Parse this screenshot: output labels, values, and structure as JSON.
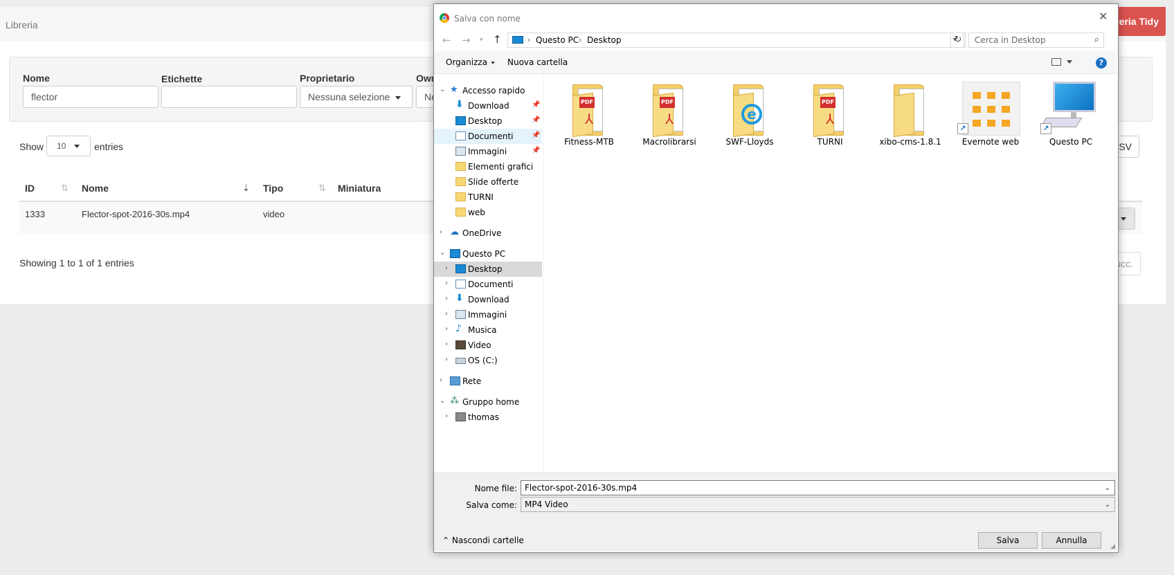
{
  "app": {
    "title": "Libreria",
    "tidy_button": "reria Tidy",
    "filters": {
      "name_label": "Nome",
      "name_value": "flector",
      "tags_label": "Etichette",
      "tags_value": "",
      "owner_label": "Proprietario",
      "owner_value": "Nessuna selezione",
      "own_label": "Owr",
      "own_value": "Ne"
    },
    "show_label": "Show",
    "entries_label": "entries",
    "page_length": "10",
    "csv_label": "CSV",
    "table": {
      "headers": [
        "ID",
        "Nome",
        "Tipo",
        "Miniatura"
      ],
      "rows": [
        {
          "id": "1333",
          "name": "Flector-spot-2016-30s.mp4",
          "type": "video",
          "thumb": ""
        }
      ]
    },
    "info": "Showing 1 to 1 of 1 entries",
    "next_label": "ucc."
  },
  "dialog": {
    "title": "Salva con nome",
    "breadcrumb": [
      "Questo PC",
      "Desktop"
    ],
    "search_placeholder": "Cerca in Desktop",
    "toolbar": {
      "organize": "Organizza",
      "new_folder": "Nuova cartella",
      "help": "?"
    },
    "nav_tree": [
      {
        "label": "Accesso rapido",
        "icon": "quick-access-star-icon"
      },
      {
        "label": "Download",
        "icon": "download-icon",
        "pinned": true
      },
      {
        "label": "Desktop",
        "icon": "desktop-icon",
        "pinned": true
      },
      {
        "label": "Documenti",
        "icon": "documents-icon",
        "pinned": true
      },
      {
        "label": "Immagini",
        "icon": "pictures-icon",
        "pinned": true
      },
      {
        "label": "Elementi grafici",
        "icon": "folder-icon"
      },
      {
        "label": "Slide offerte",
        "icon": "folder-icon"
      },
      {
        "label": "TURNI",
        "icon": "folder-icon"
      },
      {
        "label": "web",
        "icon": "folder-icon"
      },
      {
        "label": "OneDrive",
        "icon": "onedrive-icon"
      },
      {
        "label": "Questo PC",
        "icon": "this-pc-icon"
      },
      {
        "label": "Desktop",
        "icon": "desktop-icon"
      },
      {
        "label": "Documenti",
        "icon": "documents-icon"
      },
      {
        "label": "Download",
        "icon": "download-icon"
      },
      {
        "label": "Immagini",
        "icon": "pictures-icon"
      },
      {
        "label": "Musica",
        "icon": "music-icon"
      },
      {
        "label": "Video",
        "icon": "video-icon"
      },
      {
        "label": "OS (C:)",
        "icon": "drive-icon"
      },
      {
        "label": "Rete",
        "icon": "network-icon"
      },
      {
        "label": "Gruppo home",
        "icon": "homegroup-icon"
      },
      {
        "label": "thomas",
        "icon": "user-icon"
      }
    ],
    "files": [
      {
        "label": "Fitness-MTB",
        "icon": "pdf-folder-icon"
      },
      {
        "label": "Macrolibrarsi",
        "icon": "pdf-folder-icon"
      },
      {
        "label": "SWF-Lloyds",
        "icon": "ie-folder-icon"
      },
      {
        "label": "TURNI",
        "icon": "pdf-folder-icon"
      },
      {
        "label": "xibo-cms-1.8.1",
        "icon": "folder-icon"
      },
      {
        "label": "Evernote web",
        "icon": "evernote-shortcut-icon"
      },
      {
        "label": "Questo PC",
        "icon": "this-pc-shortcut-icon"
      }
    ],
    "filename_label": "Nome file:",
    "filename_value": "Flector-spot-2016-30s.mp4",
    "savetype_label": "Salva come:",
    "savetype_value": "MP4 Video",
    "hide_folders": "Nascondi cartelle",
    "save_button": "Salva",
    "cancel_button": "Annulla"
  },
  "colors": {
    "accent_red": "#d9534f",
    "windows_blue": "#1a8ad4",
    "folder_yellow": "#f3cf6a"
  }
}
